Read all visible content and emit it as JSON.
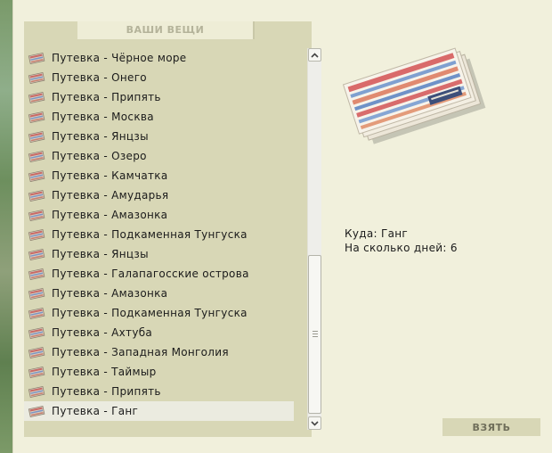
{
  "panel": {
    "title": "ВАШИ ВЕЩИ"
  },
  "items": [
    {
      "label": "Путевка - Чёрное море"
    },
    {
      "label": "Путевка - Онего"
    },
    {
      "label": "Путевка - Припять"
    },
    {
      "label": "Путевка - Москва"
    },
    {
      "label": "Путевка - Янцзы"
    },
    {
      "label": "Путевка - Озеро"
    },
    {
      "label": "Путевка - Камчатка"
    },
    {
      "label": "Путевка - Амударья"
    },
    {
      "label": "Путевка - Амазонка"
    },
    {
      "label": "Путевка - Подкаменная Тунгуска"
    },
    {
      "label": "Путевка - Янцзы"
    },
    {
      "label": "Путевка - Галапагосские острова"
    },
    {
      "label": "Путевка - Амазонка"
    },
    {
      "label": "Путевка - Подкаменная Тунгуска"
    },
    {
      "label": "Путевка - Ахтуба"
    },
    {
      "label": "Путевка - Западная Монголия"
    },
    {
      "label": "Путевка - Таймыр"
    },
    {
      "label": "Путевка - Припять"
    },
    {
      "label": "Путевка - Ганг",
      "selected": true
    }
  ],
  "item_icon": "ticket-icon",
  "details": {
    "destination_label": "Куда:",
    "destination_value": "Ганг",
    "days_label": "На сколько дней:",
    "days_value": "6"
  },
  "take_button": {
    "label": "ВЗЯТЬ"
  },
  "colors": {
    "window_bg": "#f1f0dc",
    "panel_bg": "#d8d7b6",
    "selected_bg": "#ebebe0"
  }
}
